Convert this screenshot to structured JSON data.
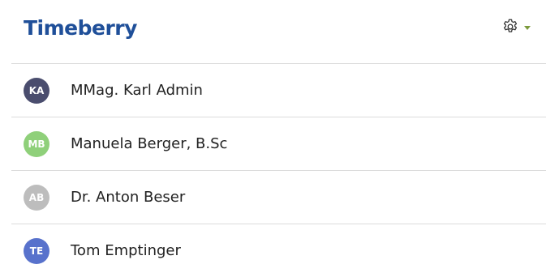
{
  "app": {
    "logo_text": "Timeberry",
    "brand_color": "#1f4f99",
    "settings_icon": "gear-icon",
    "settings_caret_icon": "caret-down-icon",
    "settings_caret_color": "#7c9a3c"
  },
  "users": [
    {
      "initials": "KA",
      "name": "MMag. Karl Admin",
      "avatar_color": "#4a4d6e"
    },
    {
      "initials": "MB",
      "name": "Manuela Berger, B.Sc",
      "avatar_color": "#8fd07a"
    },
    {
      "initials": "AB",
      "name": "Dr. Anton Beser",
      "avatar_color": "#bdbdbd"
    },
    {
      "initials": "TE",
      "name": "Tom Emptinger",
      "avatar_color": "#5872cc"
    }
  ]
}
